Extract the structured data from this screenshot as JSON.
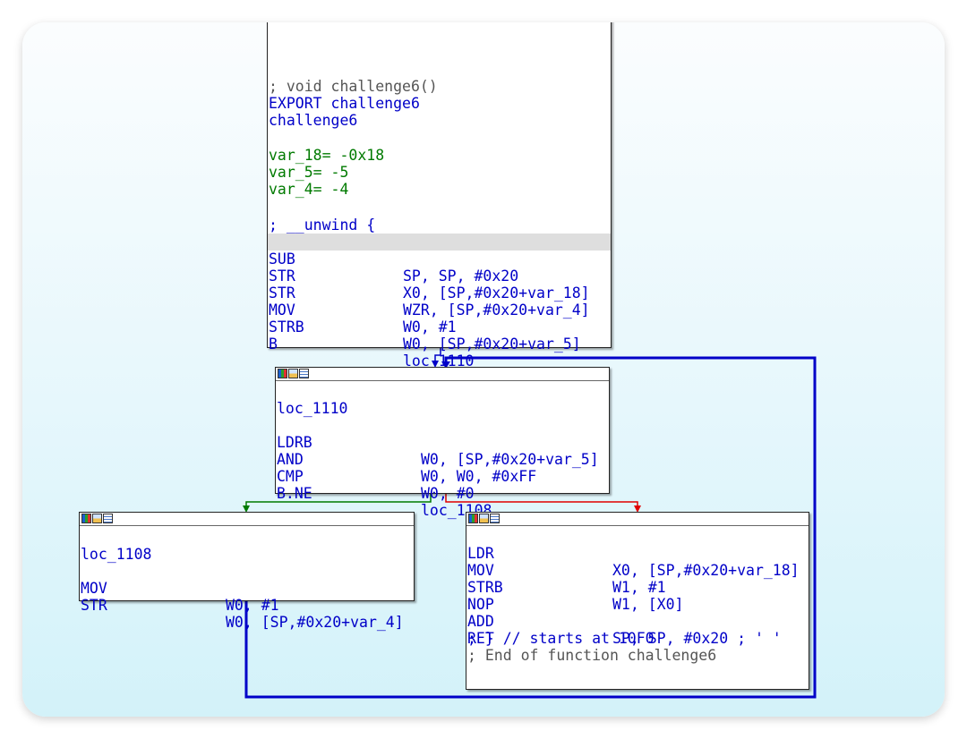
{
  "colors": {
    "mnemonic": "#0000c8",
    "operand": "#007a00",
    "comment": "#555555",
    "edge_true": "#007a00",
    "edge_false": "#e00000",
    "edge_unconditional": "#0000c8",
    "highlight": "#dedede"
  },
  "icons": [
    "graph-color-icon",
    "graph-image-icon",
    "graph-listing-icon"
  ],
  "blocks": {
    "entry": {
      "comment_signature": "; void challenge6()",
      "export_line": "EXPORT challenge6",
      "func_name": "challenge6",
      "vars": [
        {
          "name": "var_18",
          "eq": "= ",
          "value": "-0x18"
        },
        {
          "name": "var_5",
          "eq": "= ",
          "value": "-5"
        },
        {
          "name": "var_4",
          "eq": "= ",
          "value": "-4"
        }
      ],
      "unwind": "; __unwind {",
      "instructions": [
        {
          "mnemonic": "SUB",
          "operands": "SP, SP, #0x20"
        },
        {
          "mnemonic": "STR",
          "operands": "X0, [SP,#0x20+var_18]"
        },
        {
          "mnemonic": "STR",
          "operands": "WZR, [SP,#0x20+var_4]"
        },
        {
          "mnemonic": "MOV",
          "operands": "W0, #1"
        },
        {
          "mnemonic": "STRB",
          "operands": "W0, [SP,#0x20+var_5]"
        },
        {
          "mnemonic": "B",
          "operands": "loc_1110"
        }
      ]
    },
    "loop": {
      "label": "loc_1110",
      "instructions": [
        {
          "mnemonic": "LDRB",
          "operands": "W0, [SP,#0x20+var_5]"
        },
        {
          "mnemonic": "AND",
          "operands": "W0, W0, #0xFF"
        },
        {
          "mnemonic": "CMP",
          "operands": "W0, #0"
        },
        {
          "mnemonic": "B.NE",
          "operands": "loc_1108"
        }
      ]
    },
    "body": {
      "label": "loc_1108",
      "instructions": [
        {
          "mnemonic": "MOV",
          "operands": "W0, #1"
        },
        {
          "mnemonic": "STR",
          "operands": "W0, [SP,#0x20+var_4]"
        }
      ]
    },
    "exit": {
      "instructions": [
        {
          "mnemonic": "LDR",
          "operands": "X0, [SP,#0x20+var_18]"
        },
        {
          "mnemonic": "MOV",
          "operands": "W1, #1"
        },
        {
          "mnemonic": "STRB",
          "operands": "W1, [X0]"
        },
        {
          "mnemonic": "NOP",
          "operands": ""
        },
        {
          "mnemonic": "ADD",
          "operands": "SP, SP, #0x20 ; ' '"
        },
        {
          "mnemonic": "RET",
          "operands": ""
        }
      ],
      "unwind_end": "; } // starts at 10F0",
      "end_comment": "; End of function challenge6"
    }
  }
}
